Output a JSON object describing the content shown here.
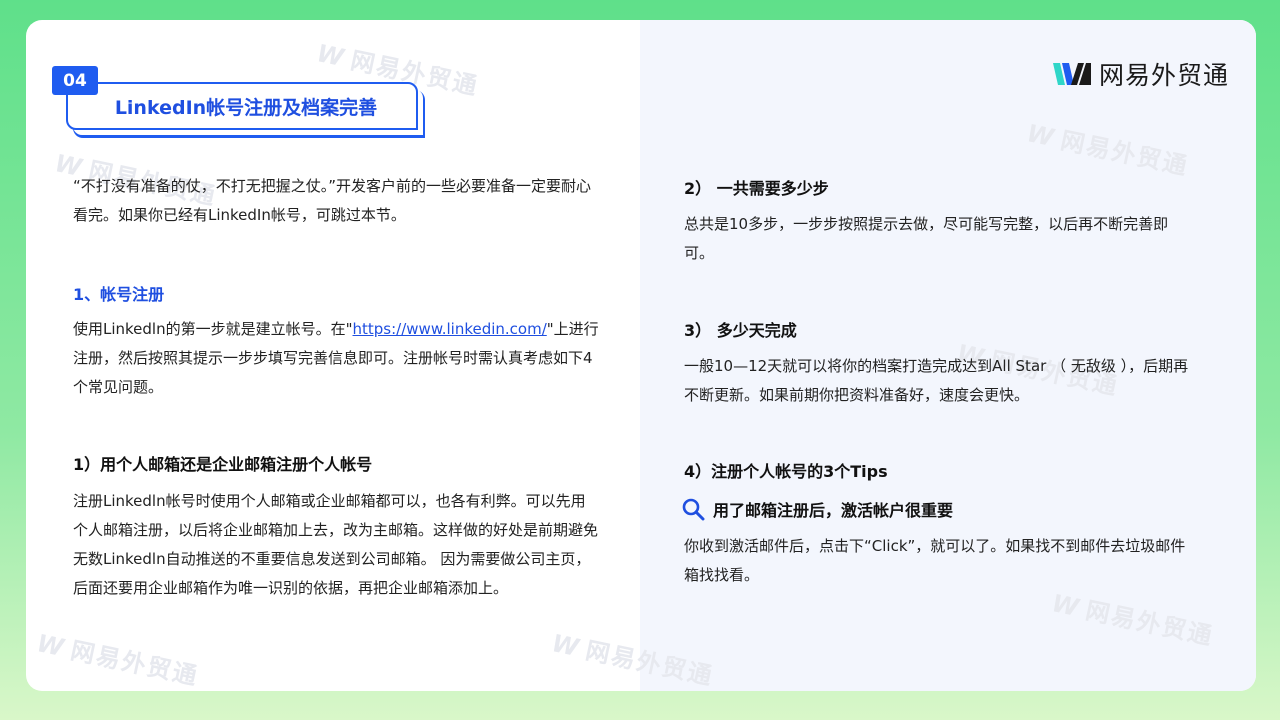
{
  "brand": {
    "name": "网易外贸通"
  },
  "section": {
    "number": "04",
    "title": "LinkedIn帐号注册及档案完善"
  },
  "left": {
    "intro": "“不打没有准备的仗，不打无把握之仗。”开发客户前的一些必要准备一定要耐心看完。如果你已经有LinkedIn帐号，可跳过本节。",
    "h1": "1、帐号注册",
    "p1_before": "使用Linkedln的第一步就是建立帐号。在\"",
    "p1_link": "https://www.linkedin.com/",
    "p1_after": "\"上进行注册，然后按照其提示一步步填写完善信息即可。注册帐号时需认真考虑如下4个常见问题。",
    "h2": "1）用个人邮箱还是企业邮箱注册个人帐号",
    "p2": "注册Linkedln帐号时使用个人邮箱或企业邮箱都可以，也各有利弊。可以先用个人邮箱注册，以后将企业邮箱加上去，改为主邮箱。这样做的好处是前期避免无数Linkedln自动推送的不重要信息发送到公司邮箱。 因为需要做公司主页，后面还要用企业邮箱作为唯一识别的依据，再把企业邮箱添加上。"
  },
  "right": {
    "h2": "2） 一共需要多少步",
    "p2": "总共是10多步，一步步按照提示去做，尽可能写完整，以后再不断完善即可。",
    "h3": "3） 多少天完成",
    "p3": "一般10—12天就可以将你的档案打造完成达到All Star （ 无敌级 ），后期再不断更新。如果前期你把资料准备好，速度会更快。",
    "h4": "4）注册个人帐号的3个Tips",
    "tip_title": "用了邮箱注册后，激活帐户很重要",
    "tip_text": "你收到激活邮件后，点击下“Click”，就可以了。如果找不到邮件去垃圾邮件箱找找看。"
  },
  "watermarks": [
    "网易外贸通",
    "网易外贸通",
    "网易外贸通",
    "网易外贸通",
    "网易外贸通",
    "网易外贸通",
    "网易外贸通"
  ],
  "colors": {
    "accent": "#1f4fe0",
    "badge": "#1f5cf0",
    "right_panel": "#f3f6fd",
    "background_green": "#5fe08a"
  },
  "icons": {
    "tip_icon": "search-icon",
    "logo_mark": "netease-waimao-logo"
  }
}
